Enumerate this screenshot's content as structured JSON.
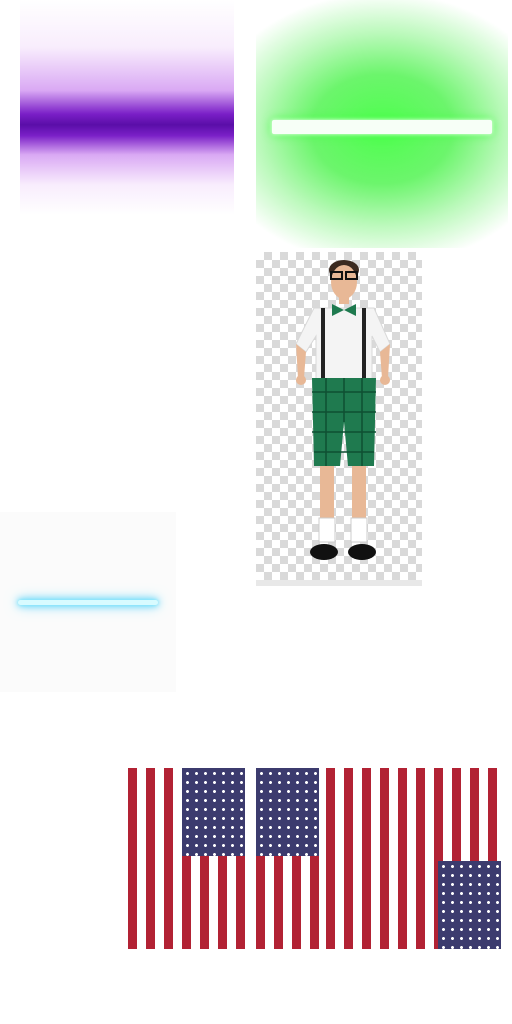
{
  "tiles": [
    {
      "name": "purple-neon-tube",
      "color": "#5a0ea8"
    },
    {
      "name": "green-neon-tube",
      "color": "#4dff4d"
    },
    {
      "name": "person-cutout",
      "color": "#1f7a4f"
    },
    {
      "name": "blue-neon-tube",
      "color": "#36c8f5"
    },
    {
      "name": "us-flag",
      "colors": [
        "#b22234",
        "#ffffff",
        "#3c3b6e"
      ]
    }
  ]
}
